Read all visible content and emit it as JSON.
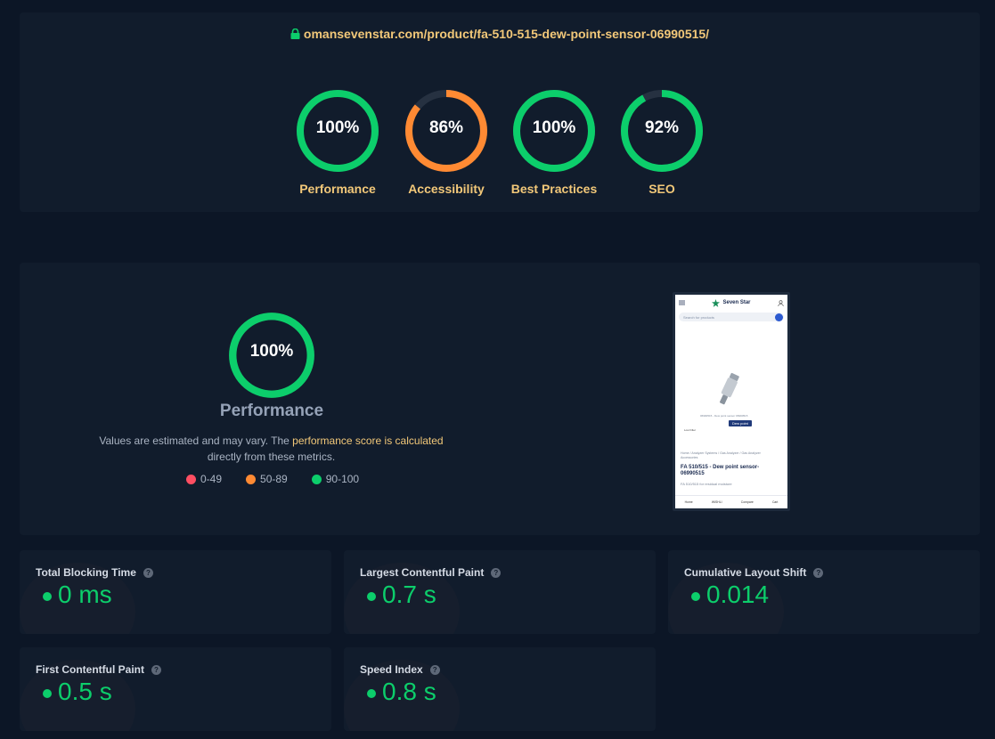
{
  "url": "omansevenstar.com/product/fa-510-515-dew-point-sensor-06990515/",
  "colors": {
    "good": "#0cce6b",
    "average": "#ff8a33",
    "poor": "#ff4e62",
    "accent": "#f2c879",
    "track": "#263141"
  },
  "categories": [
    {
      "label": "Performance",
      "score_text": "100%",
      "score": 1.0,
      "status": "good"
    },
    {
      "label": "Accessibility",
      "score_text": "86%",
      "score": 0.86,
      "status": "average"
    },
    {
      "label": "Best Practices",
      "score_text": "100%",
      "score": 1.0,
      "status": "good"
    },
    {
      "label": "SEO",
      "score_text": "92%",
      "score": 0.92,
      "status": "good"
    }
  ],
  "performance": {
    "score_text": "100%",
    "score": 1.0,
    "title": "Performance",
    "note_prefix": "Values are estimated and may vary. The ",
    "note_link": "performance score is calculated",
    "note_suffix": " directly from these metrics.",
    "legend": [
      "0-49",
      "50-89",
      "90-100"
    ]
  },
  "screenshot": {
    "brand": "Seven Star",
    "search_placeholder": "Search for products",
    "caption": "06990515 - Dew point sensor 06990515",
    "badge": "Dew point",
    "small_button": "Low Filter",
    "breadcrumb": "Home  /  Analyzer Systems  /  Gas Analyzer  /  Gas Analyzer Accessories",
    "product_title": "FA 510/515 - Dew point sensor-06990515",
    "text": "FA 510/515 for residual moisture",
    "nav": [
      "Home",
      "WISHLI",
      "Compare",
      "Cart"
    ]
  },
  "metrics": [
    {
      "name": "Total Blocking Time",
      "value": "0 ms"
    },
    {
      "name": "Largest Contentful Paint",
      "value": "0.7 s"
    },
    {
      "name": "Cumulative Layout Shift",
      "value": "0.014"
    },
    {
      "name": "First Contentful Paint",
      "value": "0.5 s"
    },
    {
      "name": "Speed Index",
      "value": "0.8 s"
    }
  ],
  "icons": {
    "lock": "lock-icon",
    "help": "help-icon",
    "menu": "hamburger-icon",
    "user": "user-icon",
    "search": "search-icon"
  }
}
